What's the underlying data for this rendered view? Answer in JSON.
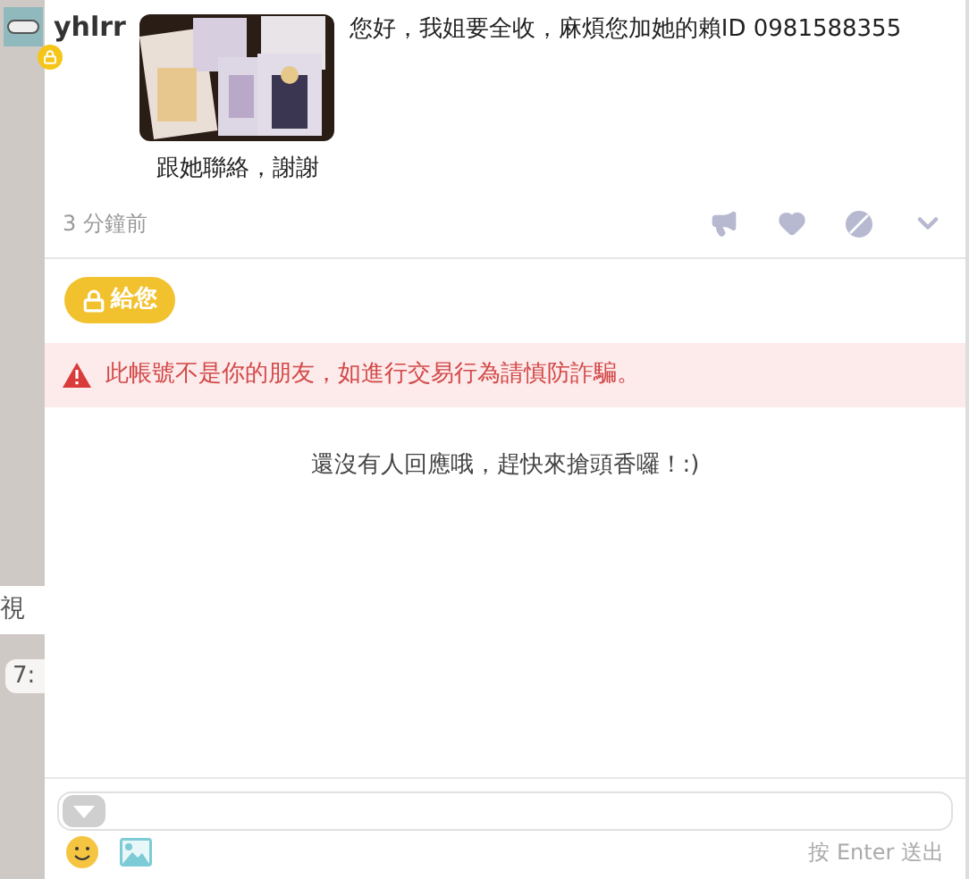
{
  "background": {
    "snippets": [
      "視",
      "7:"
    ]
  },
  "post": {
    "author": "yhlrr",
    "locked": true,
    "message": "您好，我姐要全收，麻煩您加她的賴ID 0981588355",
    "caption": "跟她聯絡，謝謝",
    "time": "3 分鐘前"
  },
  "gift_button": {
    "label": "給您"
  },
  "warning": "此帳號不是你的朋友，如進行交易行為請慎防詐騙。",
  "empty_message": "還沒有人回應哦，趕快來搶頭香囉！:)",
  "composer": {
    "hint": "按 Enter 送出"
  }
}
